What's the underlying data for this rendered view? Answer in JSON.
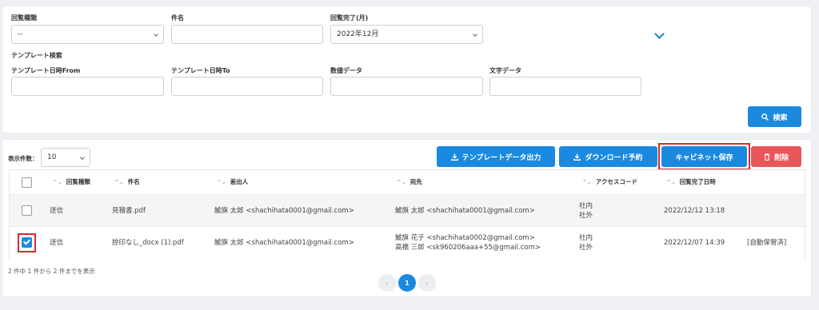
{
  "search": {
    "kairan_type_label": "回覧種類",
    "kairan_type_value": "--",
    "subject_label": "件名",
    "subject_value": "",
    "completed_month_label": "回覧完了(月)",
    "completed_month_value": "2022年12月",
    "template_search_label": "テンプレート検索",
    "template_date_from_label": "テンプレート日時From",
    "template_date_to_label": "テンプレート日時To",
    "numeric_data_label": "数値データ",
    "text_data_label": "文字データ",
    "search_button": "検索"
  },
  "list": {
    "page_size_label": "表示件数：",
    "page_size_value": "10",
    "buttons": {
      "template_export": "テンプレートデータ出力",
      "download_reserve": "ダウンロード予約",
      "cabinet_save": "キャビネット保存",
      "delete": "削除"
    },
    "columns": [
      "回覧種類",
      "件名",
      "差出人",
      "宛先",
      "アクセスコード",
      "回覧完了日時"
    ],
    "rows": [
      {
        "type": "送信",
        "subject": "見積書.pdf",
        "sender": "鯱旗 太郎 <shachihata0001@gmail.com>",
        "recipient1": "鯱旗 太郎 <shachihata0001@gmail.com>",
        "recipient2": "",
        "access1": "社内",
        "access2": "社外",
        "completed": "2022/12/12 13:18",
        "note": ""
      },
      {
        "type": "送信",
        "subject": "捺印なし_docx (1).pdf",
        "sender": "鯱旗 太郎 <shachihata0001@gmail.com>",
        "recipient1": "鯱旗 花子 <shachihata0002@gmail.com>",
        "recipient2": "高橋 三郎 <sk960206aaa+55@gmail.com>",
        "access1": "社内",
        "access2": "社外",
        "completed": "2022/12/07 14:39",
        "note": "[自動保管済]"
      }
    ],
    "summary": "2 件中 1 件から 2 件までを表示",
    "pagination": {
      "prev": "‹",
      "current": "1",
      "next": "›"
    }
  },
  "colors": {
    "primary": "#1a8ae0",
    "danger": "#e8565a",
    "highlight": "#e0262b"
  }
}
